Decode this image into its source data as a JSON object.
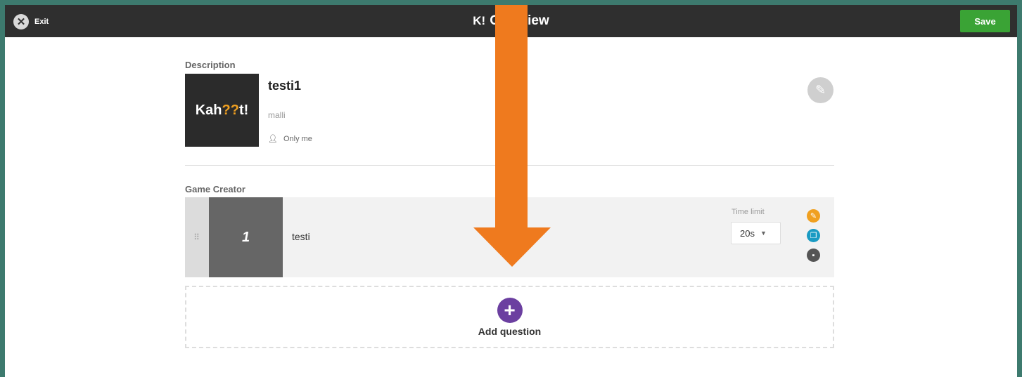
{
  "header": {
    "exit_icon": "close-icon",
    "exit_label": "Exit",
    "logo_text": "K!",
    "title": "Overview",
    "save_label": "Save"
  },
  "description_section": {
    "label": "Description",
    "cover": {
      "text_prefix": "Kah",
      "text_qq": "??",
      "text_suffix": "t!"
    },
    "quiz_title": "testi1",
    "quiz_description": "malli",
    "visibility_icon": "person-icon",
    "visibility": "Only me",
    "edit_icon": "pencil-icon"
  },
  "game_creator": {
    "label": "Game Creator",
    "questions": [
      {
        "number": "1",
        "title": "testi",
        "time_limit_label": "Time limit",
        "time_limit_value": "20s",
        "actions": [
          "edit-icon",
          "duplicate-icon",
          "delete-icon"
        ]
      }
    ],
    "add_question_label": "Add question"
  },
  "annotation": {
    "arrow_icon": "down-arrow",
    "arrow_color": "#ef7a1e"
  },
  "colors": {
    "topbar": "#2f2f2f",
    "save_green": "#3aa335",
    "add_purple": "#6b3fa0",
    "edit_orange": "#f0a020",
    "duplicate_teal": "#1a9bc3",
    "delete_gray": "#555555",
    "background_teal": "#3d7a6e"
  }
}
